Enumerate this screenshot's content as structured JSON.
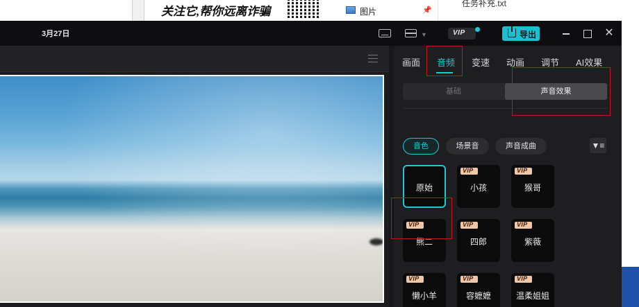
{
  "background": {
    "banner_text": "关注它,帮你远离诈骗",
    "explorer_item_label": "图片",
    "file_label": "任务补充.txt"
  },
  "titlebar": {
    "date": "3月27日",
    "vip_label": "VIP",
    "export_label": "导出",
    "close_glyph": "✕"
  },
  "panel": {
    "tabs": [
      "画面",
      "音频",
      "变速",
      "动画",
      "调节",
      "AI效果"
    ],
    "active_tab": "音频",
    "segments": {
      "basic": "基础",
      "effects": "声音效果",
      "active": "声音效果"
    },
    "chips": [
      "音色",
      "场景音",
      "声音成曲"
    ],
    "active_chip": "音色",
    "filter_glyph": "▼≡",
    "voices": [
      {
        "name": "原始",
        "vip": false,
        "selected": true
      },
      {
        "name": "小孩",
        "vip": true,
        "selected": false
      },
      {
        "name": "猴哥",
        "vip": true,
        "selected": false
      },
      {
        "name": "熊二",
        "vip": true,
        "selected": false
      },
      {
        "name": "四郎",
        "vip": true,
        "selected": false
      },
      {
        "name": "紫薇",
        "vip": true,
        "selected": false
      },
      {
        "name": "懒小羊",
        "vip": true,
        "selected": false
      },
      {
        "name": "容嬷嬷",
        "vip": true,
        "selected": false
      },
      {
        "name": "温柔姐姐",
        "vip": true,
        "selected": false
      }
    ],
    "vip_badge": "VIP"
  },
  "colors": {
    "accent": "#1ec8d8",
    "annotation": "#c01818",
    "vip_badge": "#f0c7a6"
  }
}
